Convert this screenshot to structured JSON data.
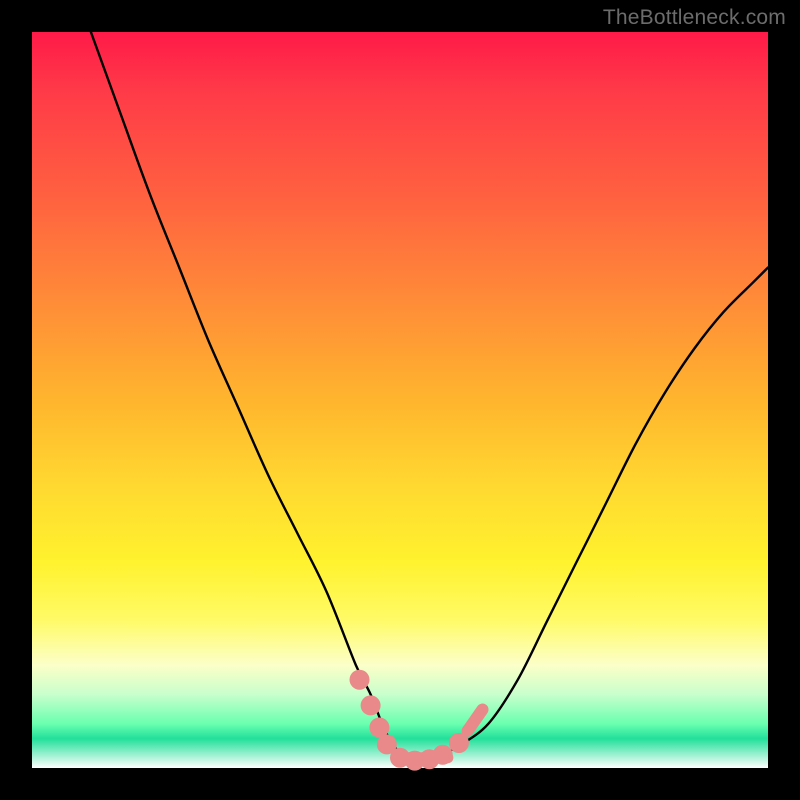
{
  "watermark": "TheBottleneck.com",
  "colors": {
    "frame": "#000000",
    "curve": "#000000",
    "marker_fill": "#e98989",
    "marker_stroke": "#d47676"
  },
  "chart_data": {
    "type": "line",
    "title": "",
    "xlabel": "",
    "ylabel": "",
    "xlim": [
      0,
      100
    ],
    "ylim": [
      0,
      100
    ],
    "series": [
      {
        "name": "bottleneck-curve",
        "x": [
          8,
          12,
          16,
          20,
          24,
          28,
          32,
          36,
          40,
          44,
          46,
          48,
          50,
          52,
          54,
          56,
          58,
          62,
          66,
          70,
          74,
          78,
          82,
          86,
          90,
          94,
          98,
          100
        ],
        "y": [
          100,
          89,
          78,
          68,
          58,
          49,
          40,
          32,
          24,
          14,
          10,
          5,
          2,
          1,
          1,
          2,
          3,
          6,
          12,
          20,
          28,
          36,
          44,
          51,
          57,
          62,
          66,
          68
        ]
      }
    ],
    "markers": [
      {
        "name": "marker-left-1",
        "x": 44.5,
        "y": 12,
        "r": 0.9
      },
      {
        "name": "marker-left-2",
        "x": 46.0,
        "y": 8.5,
        "r": 0.9
      },
      {
        "name": "marker-left-3",
        "x": 47.2,
        "y": 5.5,
        "r": 0.9
      },
      {
        "name": "marker-left-4",
        "x": 48.2,
        "y": 3.2,
        "r": 0.9
      },
      {
        "name": "marker-bottom-1",
        "x": 50.0,
        "y": 1.4,
        "r": 0.9
      },
      {
        "name": "marker-bottom-2",
        "x": 52.0,
        "y": 1.0,
        "r": 0.9
      },
      {
        "name": "marker-bottom-3",
        "x": 54.0,
        "y": 1.2,
        "r": 0.9
      },
      {
        "name": "marker-bottom-4",
        "x": 55.8,
        "y": 1.8,
        "r": 0.9
      },
      {
        "name": "marker-right-1",
        "x": 58.0,
        "y": 3.4,
        "r": 0.9
      },
      {
        "name": "marker-right-cluster",
        "x": 60.2,
        "y": 6.5,
        "r": 1.5,
        "elongated": true
      }
    ]
  }
}
